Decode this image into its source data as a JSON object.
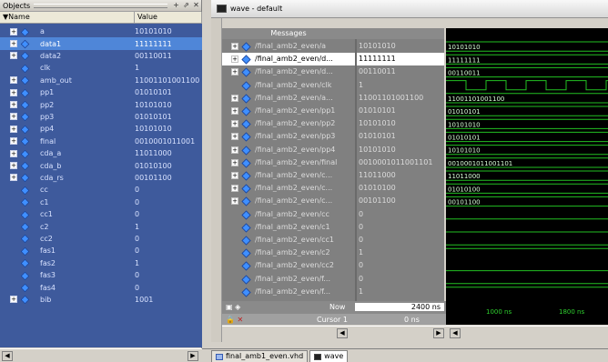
{
  "objects": {
    "title": "Objects",
    "columns": [
      "Name",
      "Value"
    ],
    "rows": [
      {
        "name": "a",
        "value": "10101010",
        "expandable": true
      },
      {
        "name": "data1",
        "value": "11111111",
        "expandable": true,
        "selected": true
      },
      {
        "name": "data2",
        "value": "00110011",
        "expandable": true
      },
      {
        "name": "clk",
        "value": "1",
        "expandable": false
      },
      {
        "name": "amb_out",
        "value": "11001101001100",
        "expandable": true
      },
      {
        "name": "pp1",
        "value": "01010101",
        "expandable": true
      },
      {
        "name": "pp2",
        "value": "10101010",
        "expandable": true
      },
      {
        "name": "pp3",
        "value": "01010101",
        "expandable": true
      },
      {
        "name": "pp4",
        "value": "10101010",
        "expandable": true
      },
      {
        "name": "final",
        "value": "0010001011001",
        "expandable": true
      },
      {
        "name": "cda_a",
        "value": "11011000",
        "expandable": true
      },
      {
        "name": "cda_b",
        "value": "01010100",
        "expandable": true
      },
      {
        "name": "cda_rs",
        "value": "00101100",
        "expandable": true
      },
      {
        "name": "cc",
        "value": "0",
        "expandable": false
      },
      {
        "name": "c1",
        "value": "0",
        "expandable": false
      },
      {
        "name": "cc1",
        "value": "0",
        "expandable": false
      },
      {
        "name": "c2",
        "value": "1",
        "expandable": false
      },
      {
        "name": "cc2",
        "value": "0",
        "expandable": false
      },
      {
        "name": "fas1",
        "value": "0",
        "expandable": false
      },
      {
        "name": "fas2",
        "value": "1",
        "expandable": false
      },
      {
        "name": "fas3",
        "value": "0",
        "expandable": false
      },
      {
        "name": "fas4",
        "value": "0",
        "expandable": false
      },
      {
        "name": "bib",
        "value": "1001",
        "expandable": true
      }
    ]
  },
  "wave": {
    "title": "wave - default",
    "messages_header": "Messages",
    "rows": [
      {
        "name": "/final_amb2_even/a",
        "value": "10101010",
        "expandable": true,
        "wave": "10101010"
      },
      {
        "name": "/final_amb2_even/d...",
        "value": "11111111",
        "expandable": true,
        "selected": true,
        "wave": "11111111"
      },
      {
        "name": "/final_amb2_even/d...",
        "value": "00110011",
        "expandable": true,
        "wave": "00110011"
      },
      {
        "name": "/final_amb2_even/clk",
        "value": "1",
        "expandable": false,
        "clock": true
      },
      {
        "name": "/final_amb2_even/a...",
        "value": "11001101001100",
        "expandable": true,
        "wave": "11001101001100"
      },
      {
        "name": "/final_amb2_even/pp1",
        "value": "01010101",
        "expandable": true,
        "wave": "01010101"
      },
      {
        "name": "/final_amb2_even/pp2",
        "value": "10101010",
        "expandable": true,
        "wave": "10101010"
      },
      {
        "name": "/final_amb2_even/pp3",
        "value": "01010101",
        "expandable": true,
        "wave": "01010101"
      },
      {
        "name": "/final_amb2_even/pp4",
        "value": "10101010",
        "expandable": true,
        "wave": "10101010"
      },
      {
        "name": "/final_amb2_even/final",
        "value": "0010001011001101",
        "expandable": true,
        "wave": "0010001011001101"
      },
      {
        "name": "/final_amb2_even/c...",
        "value": "11011000",
        "expandable": true,
        "wave": "11011000"
      },
      {
        "name": "/final_amb2_even/c...",
        "value": "01010100",
        "expandable": true,
        "wave": "01010100"
      },
      {
        "name": "/final_amb2_even/c...",
        "value": "00101100",
        "expandable": true,
        "wave": "00101100"
      },
      {
        "name": "/final_amb2_even/cc",
        "value": "0",
        "expandable": false,
        "level": 0
      },
      {
        "name": "/final_amb2_even/c1",
        "value": "0",
        "expandable": false,
        "level": 0
      },
      {
        "name": "/final_amb2_even/cc1",
        "value": "0",
        "expandable": false,
        "level": 0
      },
      {
        "name": "/final_amb2_even/c2",
        "value": "1",
        "expandable": false,
        "level": 1
      },
      {
        "name": "/final_amb2_even/cc2",
        "value": "0",
        "expandable": false,
        "level": 0
      },
      {
        "name": "/final_amb2_even/f...",
        "value": "0",
        "expandable": false,
        "level": 0
      },
      {
        "name": "/final_amb2_even/f...",
        "value": "1",
        "expandable": false,
        "level": 1
      }
    ],
    "now_label": "Now",
    "now_value": "2400 ns",
    "cursor_label": "Cursor 1",
    "cursor_value": "0 ns",
    "ticks": [
      "1000 ns",
      "1800 ns"
    ]
  },
  "tabs": [
    {
      "label": "final_amb1_even.vhd",
      "active": false
    },
    {
      "label": "wave",
      "active": true
    }
  ]
}
